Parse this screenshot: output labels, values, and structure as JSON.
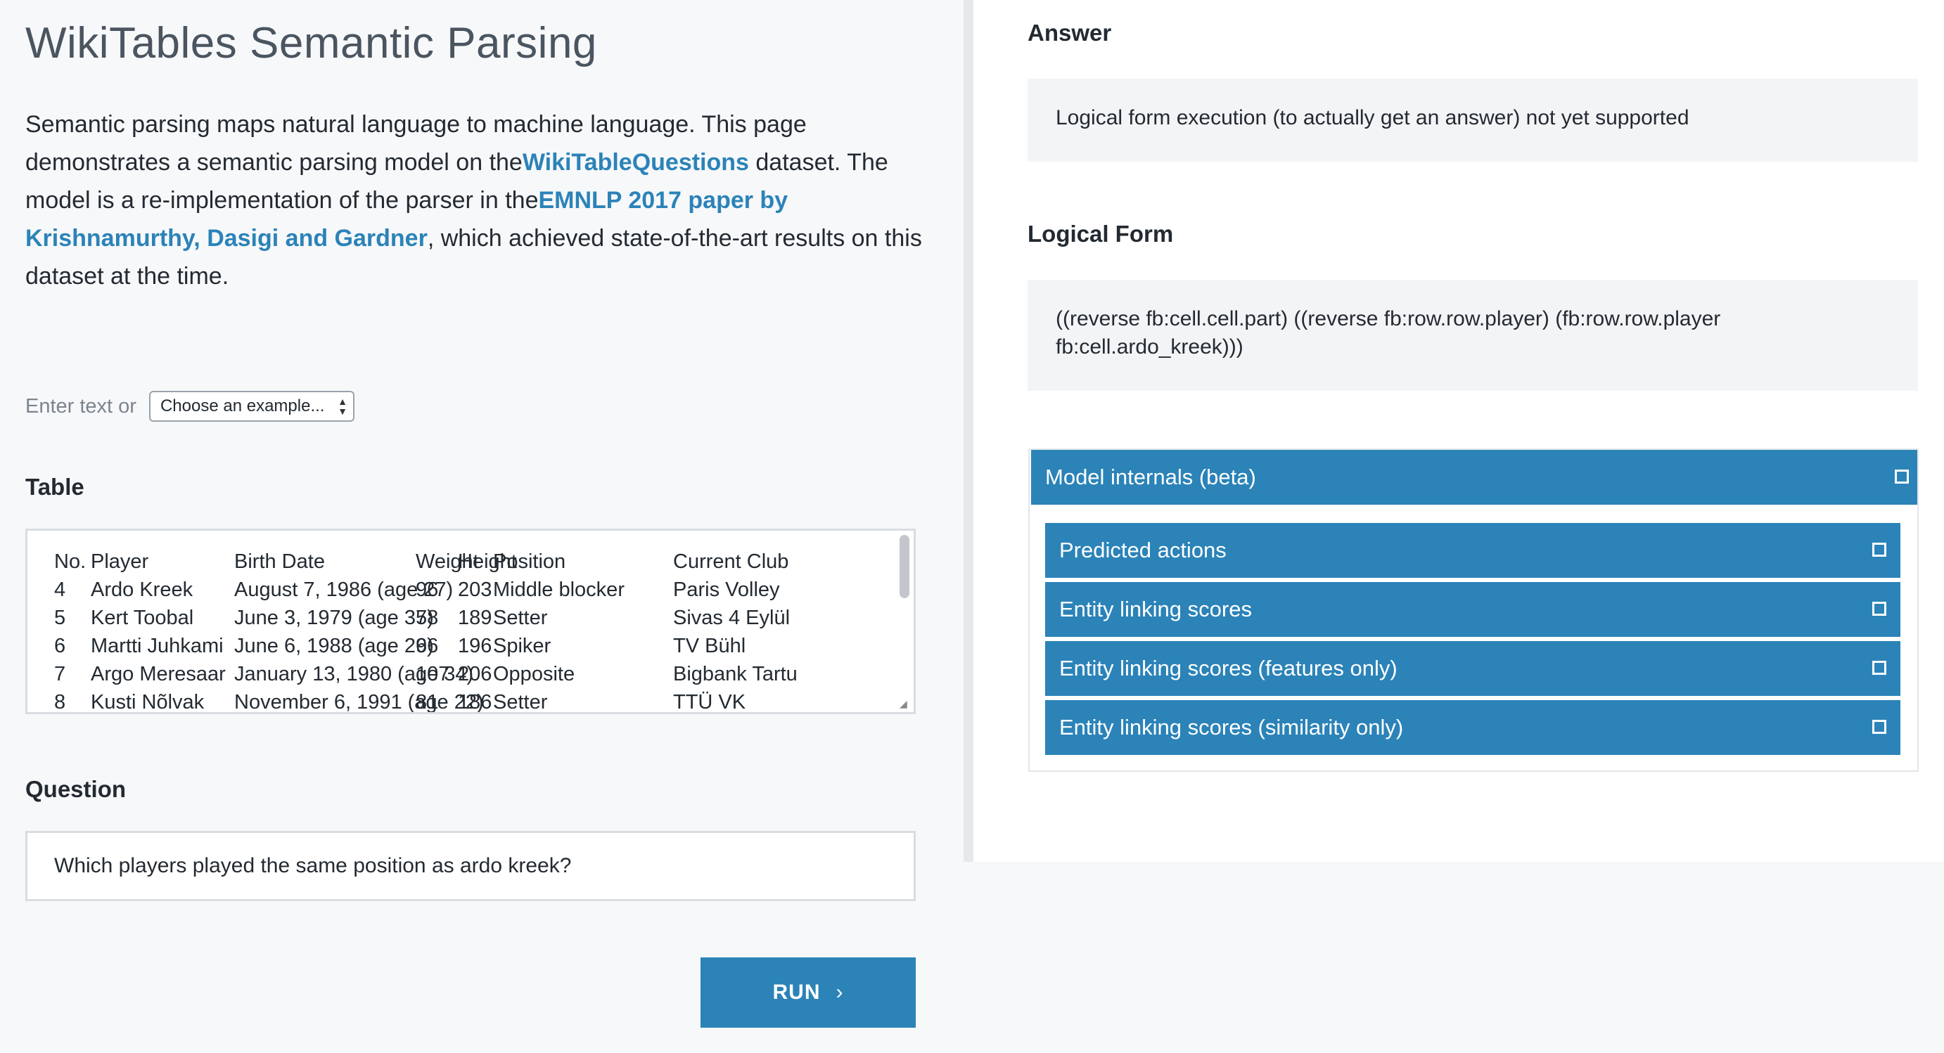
{
  "page": {
    "title": "WikiTables Semantic Parsing",
    "intro": {
      "t1": "Semantic parsing maps natural language to machine language. This page demonstrates a semantic parsing model on the",
      "link1": "WikiTableQuestions",
      "t2": " dataset. The model is a re-implementation of the parser in the",
      "link2": "EMNLP 2017 paper by Krishnamurthy, Dasigi and Gardner",
      "t3": ", which achieved state-of-the-art results on this dataset at the time."
    }
  },
  "input": {
    "enter_text_label": "Enter text or",
    "example_select_value": "Choose an example...",
    "table_label": "Table",
    "table": {
      "header": [
        "No.",
        "Player",
        "Birth Date",
        "Weight",
        "Height",
        "Position",
        "Current Club"
      ],
      "rows": [
        [
          "4",
          "Ardo Kreek",
          "August 7, 1986 (age 27)",
          "96",
          "203",
          "Middle blocker",
          "Paris Volley"
        ],
        [
          "5",
          "Kert Toobal",
          "June 3, 1979 (age 35)",
          "78",
          "189",
          "Setter",
          "Sivas 4 Eylül"
        ],
        [
          "6",
          "Martti Juhkami",
          "June 6, 1988 (age 26)",
          "96",
          "196",
          "Spiker",
          "TV Bühl"
        ],
        [
          "7",
          "Argo Meresaar",
          "January 13, 1980 (age 34)",
          "107",
          "206",
          "Opposite",
          "Bigbank Tartu"
        ],
        [
          "8",
          "Kusti Nõlvak",
          "November 6, 1991 (age 22)",
          "81",
          "186",
          "Setter",
          "TTÜ VK"
        ]
      ]
    },
    "question_label": "Question",
    "question_value": "Which players played the same position as ardo kreek?",
    "run_label": "RUN",
    "run_icon": "chevron-right-icon"
  },
  "output": {
    "answer_label": "Answer",
    "answer_value": "Logical form execution (to actually get an answer) not yet supported",
    "logical_form_label": "Logical Form",
    "logical_form_line1": "((reverse fb:cell.cell.part) ((reverse fb:row.row.player) (fb:row.row.player",
    "logical_form_line2": "fb:cell.ardo_kreek)))",
    "internals_label": "Model internals (beta)",
    "panels": [
      {
        "label": "Predicted actions"
      },
      {
        "label": "Entity linking scores"
      },
      {
        "label": "Entity linking scores (features only)"
      },
      {
        "label": "Entity linking scores (similarity only)"
      }
    ]
  },
  "colors": {
    "accent": "#2b83b8",
    "background": "#f7f8fa",
    "panel_bg": "#f3f4f6"
  }
}
